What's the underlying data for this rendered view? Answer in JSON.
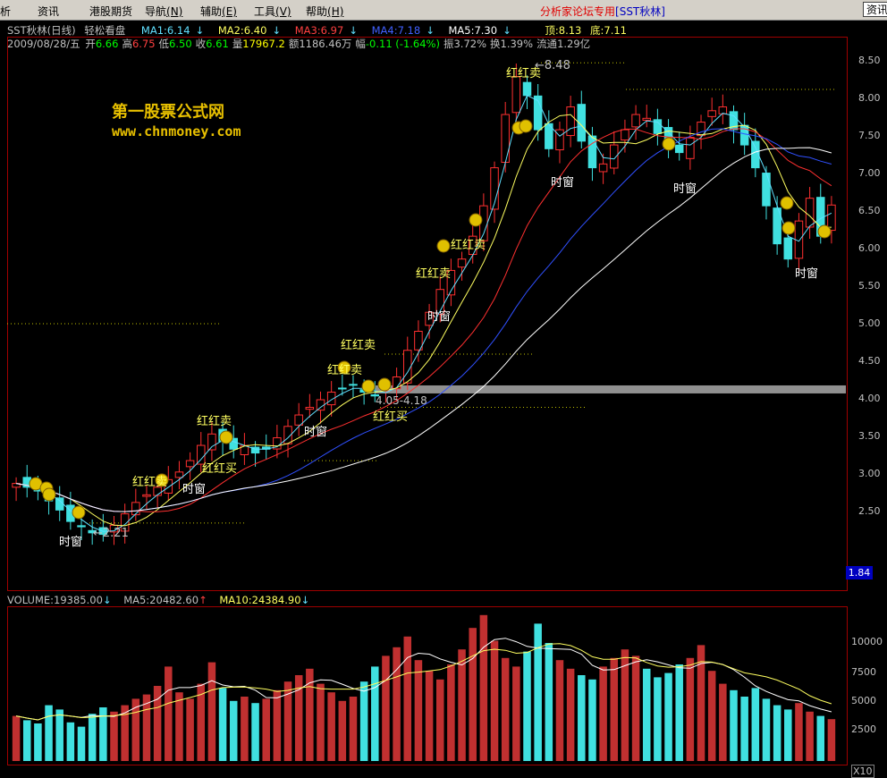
{
  "menu": {
    "items": [
      {
        "label": "析",
        "shortcut": ""
      },
      {
        "label": "资讯",
        "shortcut": ""
      },
      {
        "label": "港股期货",
        "shortcut": ""
      },
      {
        "label": "导航",
        "shortcut": "(N)"
      },
      {
        "label": "辅助",
        "shortcut": "(E)"
      },
      {
        "label": "工具",
        "shortcut": "(V)"
      },
      {
        "label": "帮助",
        "shortcut": "(H)"
      }
    ],
    "brand_text": "分析家论坛专用",
    "brand_stock": "[SST秋林]",
    "search_label": "资讯"
  },
  "header": {
    "title": "SST秋林(日线)",
    "mode": "轻松看盘",
    "ma": [
      {
        "label": "MA1:6.14",
        "color": "#60e0ff"
      },
      {
        "label": "MA2:6.40",
        "color": "#ffff60"
      },
      {
        "label": "MA3:6.97",
        "color": "#ff4040"
      },
      {
        "label": "MA4:7.18",
        "color": "#4060ff"
      },
      {
        "label": "MA5:7.30",
        "color": "#ffffff"
      }
    ],
    "top_label": "顶:8.13",
    "bottom_label": "底:7.11",
    "date": "2009/08/28/五",
    "quote": [
      {
        "k": "开",
        "v": "6.66",
        "color": "#00ff00"
      },
      {
        "k": "高",
        "v": "6.75",
        "color": "#ff4040"
      },
      {
        "k": "低",
        "v": "6.50",
        "color": "#00ff00"
      },
      {
        "k": "收",
        "v": "6.61",
        "color": "#00ff00"
      },
      {
        "k": "量",
        "v": "17967.2",
        "color": "#ffff00"
      },
      {
        "k": "额",
        "v": "1186.46万",
        "color": "#c0c0c0"
      },
      {
        "k": "幅",
        "v": "-0.11 (-1.64%)",
        "color": "#00ff00"
      },
      {
        "k": "振",
        "v": "3.72%",
        "color": "#c0c0c0"
      },
      {
        "k": "换",
        "v": "1.39%",
        "color": "#c0c0c0"
      },
      {
        "k": "流通",
        "v": "1.29亿",
        "color": "#c0c0c0"
      }
    ]
  },
  "watermark": {
    "line1": "第一股票公式网",
    "line2": "www.chnmoney.com"
  },
  "price_axis": [
    "8.50",
    "8.00",
    "7.50",
    "7.00",
    "6.50",
    "6.00",
    "5.50",
    "5.00",
    "4.50",
    "4.00",
    "3.50",
    "3.00",
    "2.50"
  ],
  "current_price_label": "1.84",
  "annotations": {
    "high": "8.48",
    "low": "2.21",
    "range": "4.05-4.18",
    "signals": [
      {
        "text": "时窗",
        "color": "#ffffff"
      },
      {
        "text": "红红卖",
        "color": "#ffff60"
      },
      {
        "text": "时窗",
        "color": "#ffffff"
      },
      {
        "text": "红红卖",
        "color": "#ffff60"
      },
      {
        "text": "红红买",
        "color": "#ffff60"
      },
      {
        "text": "时窗",
        "color": "#ffffff"
      },
      {
        "text": "红红卖",
        "color": "#ffff60"
      },
      {
        "text": "红红卖",
        "color": "#ffff60"
      },
      {
        "text": "红红买",
        "color": "#ffff60"
      },
      {
        "text": "红红卖",
        "color": "#ffff60"
      },
      {
        "text": "时窗",
        "color": "#ffffff"
      },
      {
        "text": "红红卖",
        "color": "#ffff60"
      },
      {
        "text": "红红卖",
        "color": "#ffff60"
      },
      {
        "text": "时窗",
        "color": "#ffffff"
      },
      {
        "text": "时窗",
        "color": "#ffffff"
      },
      {
        "text": "时窗",
        "color": "#ffffff"
      }
    ]
  },
  "volume": {
    "label": "VOLUME:19385.00",
    "ma5": "MA5:20482.60",
    "ma10": "MA10:24384.90",
    "axis": [
      "10000",
      "7500",
      "5000",
      "2500"
    ],
    "scale": "X10"
  },
  "colors": {
    "up": "#ff3030",
    "down": "#40e0e0",
    "frame": "#a00000"
  },
  "chart_data": {
    "type": "candlestick",
    "title": "SST秋林(日线)",
    "ylim": [
      1.84,
      8.8
    ],
    "close": [
      2.95,
      2.9,
      2.85,
      2.72,
      2.6,
      2.45,
      2.38,
      2.3,
      2.28,
      2.4,
      2.55,
      2.7,
      2.8,
      2.9,
      3.0,
      3.1,
      3.25,
      3.45,
      3.6,
      3.5,
      3.4,
      3.45,
      3.35,
      3.4,
      3.55,
      3.7,
      3.85,
      3.95,
      4.05,
      4.15,
      4.2,
      4.25,
      4.15,
      4.1,
      4.18,
      4.35,
      4.7,
      4.95,
      5.2,
      5.5,
      5.75,
      5.9,
      6.2,
      6.6,
      7.1,
      7.8,
      8.3,
      8.05,
      7.6,
      7.35,
      7.6,
      7.9,
      7.45,
      7.1,
      7.15,
      7.4,
      7.6,
      7.8,
      7.75,
      7.55,
      7.4,
      7.3,
      7.5,
      7.7,
      7.85,
      7.9,
      7.6,
      7.4,
      7.1,
      6.6,
      6.1,
      5.9,
      6.4,
      6.7,
      6.2,
      6.61
    ],
    "volume": [
      4200,
      3800,
      3500,
      5200,
      4800,
      3600,
      3200,
      4400,
      5000,
      4600,
      5200,
      5800,
      6200,
      7000,
      8800,
      6400,
      5800,
      7200,
      9200,
      6800,
      5600,
      6000,
      5400,
      5800,
      6600,
      7400,
      8000,
      8600,
      7200,
      6400,
      5600,
      6000,
      7400,
      8800,
      9800,
      10600,
      11600,
      9400,
      8400,
      7600,
      9000,
      10400,
      12400,
      13600,
      11200,
      9600,
      8800,
      10200,
      12800,
      11000,
      9400,
      8600,
      8000,
      7600,
      8800,
      9600,
      10400,
      9800,
      8600,
      7800,
      8200,
      9000,
      9600,
      10800,
      8400,
      7200,
      6600,
      6000,
      6800,
      5800,
      5200,
      4800,
      5400,
      4600,
      4200,
      3900
    ],
    "ma5_vol": 20482.6,
    "ma10_vol": 24384.9,
    "support_band": 4.18
  }
}
